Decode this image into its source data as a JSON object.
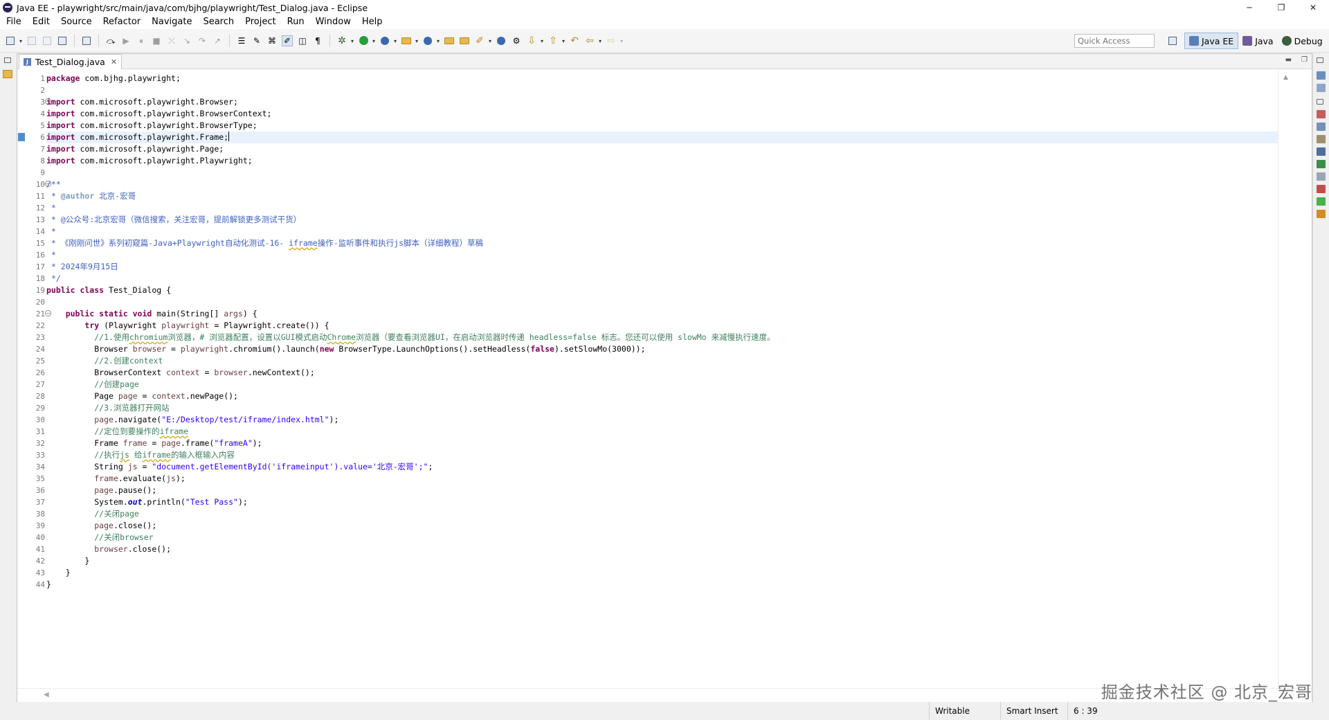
{
  "window": {
    "title": "Java EE - playwright/src/main/java/com/bjhg/playwright/Test_Dialog.java - Eclipse",
    "controls": [
      "─",
      "❐",
      "✕"
    ]
  },
  "menubar": [
    "File",
    "Edit",
    "Source",
    "Refactor",
    "Navigate",
    "Search",
    "Project",
    "Run",
    "Window",
    "Help"
  ],
  "toolbar": {
    "quick_access_placeholder": "Quick Access",
    "perspectives": [
      {
        "label": "Java EE",
        "active": true,
        "icon": "java-ee-perspective-icon"
      },
      {
        "label": "Java",
        "active": false,
        "icon": "java-perspective-icon"
      },
      {
        "label": "Debug",
        "active": false,
        "icon": "debug-perspective-icon"
      }
    ]
  },
  "editor": {
    "tab_label": "Test_Dialog.java",
    "current_line": 6,
    "lines": [
      {
        "n": "1",
        "tokens": [
          {
            "c": "kw",
            "t": "package"
          },
          {
            "c": "",
            "t": " com.bjhg.playwright;"
          }
        ]
      },
      {
        "n": "2",
        "tokens": []
      },
      {
        "n": "3",
        "fold": true,
        "tokens": [
          {
            "c": "kw",
            "t": "import"
          },
          {
            "c": "",
            "t": " com.microsoft.playwright.Browser;"
          }
        ]
      },
      {
        "n": "4",
        "tokens": [
          {
            "c": "kw",
            "t": "import"
          },
          {
            "c": "",
            "t": " com.microsoft.playwright.BrowserContext;"
          }
        ]
      },
      {
        "n": "5",
        "tokens": [
          {
            "c": "kw",
            "t": "import"
          },
          {
            "c": "",
            "t": " com.microsoft.playwright.BrowserType;"
          }
        ]
      },
      {
        "n": "6",
        "caret": true,
        "tokens": [
          {
            "c": "kw",
            "t": "import"
          },
          {
            "c": "",
            "t": " com.microsoft.playwright.Frame;"
          }
        ]
      },
      {
        "n": "7",
        "tokens": [
          {
            "c": "kw",
            "t": "import"
          },
          {
            "c": "",
            "t": " com.microsoft.playwright.Page;"
          }
        ]
      },
      {
        "n": "8",
        "tokens": [
          {
            "c": "kw",
            "t": "import"
          },
          {
            "c": "",
            "t": " com.microsoft.playwright.Playwright;"
          }
        ]
      },
      {
        "n": "9",
        "tokens": []
      },
      {
        "n": "10",
        "fold": true,
        "tokens": [
          {
            "c": "jd",
            "t": "/**"
          }
        ]
      },
      {
        "n": "11",
        "tokens": [
          {
            "c": "jd",
            "t": " * "
          },
          {
            "c": "tag",
            "t": "@author"
          },
          {
            "c": "jd",
            "t": " 北京-宏哥"
          }
        ]
      },
      {
        "n": "12",
        "tokens": [
          {
            "c": "jd",
            "t": " *"
          }
        ]
      },
      {
        "n": "13",
        "tokens": [
          {
            "c": "jd",
            "t": " * @公众号:北京宏哥（微信搜索，关注宏哥，提前解锁更多测试干货）"
          }
        ]
      },
      {
        "n": "14",
        "tokens": [
          {
            "c": "jd",
            "t": " *"
          }
        ]
      },
      {
        "n": "15",
        "tokens": [
          {
            "c": "jd",
            "t": " * 《刚刚问世》系列初窥篇-Java+Playwright自动化测试-16- "
          },
          {
            "c": "jd sp",
            "t": "iframe"
          },
          {
            "c": "jd",
            "t": "操作-监听事件和执行js脚本（详细教程）草稿"
          }
        ]
      },
      {
        "n": "16",
        "tokens": [
          {
            "c": "jd",
            "t": " *"
          }
        ]
      },
      {
        "n": "17",
        "tokens": [
          {
            "c": "jd",
            "t": " * 2024年9月15日"
          }
        ]
      },
      {
        "n": "18",
        "tokens": [
          {
            "c": "jd",
            "t": " */"
          }
        ]
      },
      {
        "n": "19",
        "tokens": [
          {
            "c": "kw",
            "t": "public class"
          },
          {
            "c": "",
            "t": " Test_Dialog {"
          }
        ]
      },
      {
        "n": "20",
        "tokens": []
      },
      {
        "n": "21",
        "fold": true,
        "tokens": [
          {
            "c": "",
            "t": "    "
          },
          {
            "c": "kw",
            "t": "public static void"
          },
          {
            "c": "",
            "t": " main(String[] "
          },
          {
            "c": "var",
            "t": "args"
          },
          {
            "c": "",
            "t": ") {"
          }
        ]
      },
      {
        "n": "22",
        "tokens": [
          {
            "c": "",
            "t": "        "
          },
          {
            "c": "kw",
            "t": "try"
          },
          {
            "c": "",
            "t": " (Playwright "
          },
          {
            "c": "var",
            "t": "playwright"
          },
          {
            "c": "",
            "t": " = Playwright.create()) {"
          }
        ]
      },
      {
        "n": "23",
        "tokens": [
          {
            "c": "",
            "t": "          "
          },
          {
            "c": "cm",
            "t": "//1.使用"
          },
          {
            "c": "cm sp",
            "t": "chromium"
          },
          {
            "c": "cm",
            "t": "浏览器，# 浏览器配置，设置以GUI模式启动"
          },
          {
            "c": "cm sp",
            "t": "Chrome"
          },
          {
            "c": "cm",
            "t": "浏览器（要查看浏览器UI，在启动浏览器时传递 headless=false 标志。您还可以使用 slowMo 来减慢执行速度。"
          }
        ]
      },
      {
        "n": "24",
        "tokens": [
          {
            "c": "",
            "t": "          Browser "
          },
          {
            "c": "var",
            "t": "browser"
          },
          {
            "c": "",
            "t": " = "
          },
          {
            "c": "var",
            "t": "playwright"
          },
          {
            "c": "",
            "t": ".chromium().launch("
          },
          {
            "c": "kw",
            "t": "new"
          },
          {
            "c": "",
            "t": " BrowserType.LaunchOptions().setHeadless("
          },
          {
            "c": "kw",
            "t": "false"
          },
          {
            "c": "",
            "t": ").setSlowMo(3000));"
          }
        ]
      },
      {
        "n": "25",
        "tokens": [
          {
            "c": "",
            "t": "          "
          },
          {
            "c": "cm",
            "t": "//2.创建context"
          }
        ]
      },
      {
        "n": "26",
        "tokens": [
          {
            "c": "",
            "t": "          BrowserContext "
          },
          {
            "c": "var",
            "t": "context"
          },
          {
            "c": "",
            "t": " = "
          },
          {
            "c": "var",
            "t": "browser"
          },
          {
            "c": "",
            "t": ".newContext();"
          }
        ]
      },
      {
        "n": "27",
        "tokens": [
          {
            "c": "",
            "t": "          "
          },
          {
            "c": "cm",
            "t": "//创建page"
          }
        ]
      },
      {
        "n": "28",
        "tokens": [
          {
            "c": "",
            "t": "          Page "
          },
          {
            "c": "var",
            "t": "page"
          },
          {
            "c": "",
            "t": " = "
          },
          {
            "c": "var",
            "t": "context"
          },
          {
            "c": "",
            "t": ".newPage();"
          }
        ]
      },
      {
        "n": "29",
        "tokens": [
          {
            "c": "",
            "t": "          "
          },
          {
            "c": "cm",
            "t": "//3.浏览器打开网站"
          }
        ]
      },
      {
        "n": "30",
        "tokens": [
          {
            "c": "",
            "t": "          "
          },
          {
            "c": "var",
            "t": "page"
          },
          {
            "c": "",
            "t": ".navigate("
          },
          {
            "c": "str",
            "t": "\"E:/Desktop/test/iframe/index.html\""
          },
          {
            "c": "",
            "t": ");"
          }
        ]
      },
      {
        "n": "31",
        "tokens": [
          {
            "c": "",
            "t": "          "
          },
          {
            "c": "cm",
            "t": "//定位到要操作的"
          },
          {
            "c": "cm sp",
            "t": "iframe"
          }
        ]
      },
      {
        "n": "32",
        "tokens": [
          {
            "c": "",
            "t": "          Frame "
          },
          {
            "c": "var",
            "t": "frame"
          },
          {
            "c": "",
            "t": " = "
          },
          {
            "c": "var",
            "t": "page"
          },
          {
            "c": "",
            "t": ".frame("
          },
          {
            "c": "str",
            "t": "\"frameA\""
          },
          {
            "c": "",
            "t": ");"
          }
        ]
      },
      {
        "n": "33",
        "tokens": [
          {
            "c": "",
            "t": "          "
          },
          {
            "c": "cm",
            "t": "//执行"
          },
          {
            "c": "cm sp",
            "t": "js"
          },
          {
            "c": "cm",
            "t": " 给"
          },
          {
            "c": "cm sp",
            "t": "iframe"
          },
          {
            "c": "cm",
            "t": "的输入框输入内容"
          }
        ]
      },
      {
        "n": "34",
        "tokens": [
          {
            "c": "",
            "t": "          String "
          },
          {
            "c": "var",
            "t": "js"
          },
          {
            "c": "",
            "t": " = "
          },
          {
            "c": "str",
            "t": "\"document.getElementById('iframeinput').value='北京-宏哥';\""
          },
          {
            "c": "",
            "t": ";"
          }
        ]
      },
      {
        "n": "35",
        "tokens": [
          {
            "c": "",
            "t": "          "
          },
          {
            "c": "var",
            "t": "frame"
          },
          {
            "c": "",
            "t": ".evaluate("
          },
          {
            "c": "var",
            "t": "js"
          },
          {
            "c": "",
            "t": ");"
          }
        ]
      },
      {
        "n": "36",
        "tokens": [
          {
            "c": "",
            "t": "          "
          },
          {
            "c": "var",
            "t": "page"
          },
          {
            "c": "",
            "t": ".pause();"
          }
        ]
      },
      {
        "n": "37",
        "tokens": [
          {
            "c": "",
            "t": "          System."
          },
          {
            "c": "fld",
            "t": "out"
          },
          {
            "c": "",
            "t": ".println("
          },
          {
            "c": "str",
            "t": "\"Test Pass\""
          },
          {
            "c": "",
            "t": ");"
          }
        ]
      },
      {
        "n": "38",
        "tokens": [
          {
            "c": "",
            "t": "          "
          },
          {
            "c": "cm",
            "t": "//关闭page"
          }
        ]
      },
      {
        "n": "39",
        "tokens": [
          {
            "c": "",
            "t": "          "
          },
          {
            "c": "var",
            "t": "page"
          },
          {
            "c": "",
            "t": ".close();"
          }
        ]
      },
      {
        "n": "40",
        "tokens": [
          {
            "c": "",
            "t": "          "
          },
          {
            "c": "cm",
            "t": "//关闭browser"
          }
        ]
      },
      {
        "n": "41",
        "tokens": [
          {
            "c": "",
            "t": "          "
          },
          {
            "c": "var",
            "t": "browser"
          },
          {
            "c": "",
            "t": ".close();"
          }
        ]
      },
      {
        "n": "42",
        "tokens": [
          {
            "c": "",
            "t": "        }"
          }
        ]
      },
      {
        "n": "43",
        "tokens": [
          {
            "c": "",
            "t": "    }"
          }
        ]
      },
      {
        "n": "44",
        "tokens": [
          {
            "c": "",
            "t": "}"
          }
        ]
      }
    ]
  },
  "statusbar": {
    "writable": "Writable",
    "insert_mode": "Smart Insert",
    "position": "6 : 39"
  },
  "watermark": "掘金技术社区 @ 北京_宏哥",
  "colors": {
    "keyword": "#7f0055",
    "comment": "#3f7f5f",
    "javadoc": "#3f5fbf",
    "string": "#2a00ff",
    "local_variable": "#6a3e3e",
    "current_line": "#e8f2fe"
  }
}
